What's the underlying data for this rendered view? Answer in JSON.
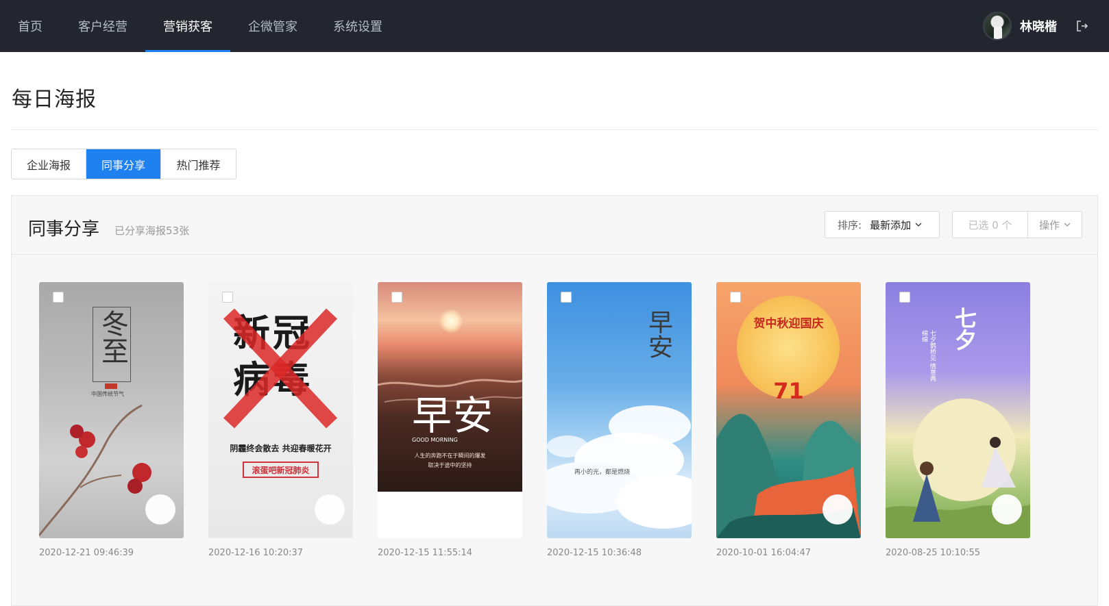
{
  "nav": {
    "items": [
      {
        "label": "首页",
        "active": false
      },
      {
        "label": "客户经营",
        "active": false
      },
      {
        "label": "营销获客",
        "active": true
      },
      {
        "label": "企微管家",
        "active": false
      },
      {
        "label": "系统设置",
        "active": false
      }
    ],
    "username": "林晓楷"
  },
  "page": {
    "title": "每日海报"
  },
  "tabs": [
    {
      "label": "企业海报",
      "active": false
    },
    {
      "label": "同事分享",
      "active": true
    },
    {
      "label": "热门推荐",
      "active": false
    }
  ],
  "panel": {
    "title": "同事分享",
    "subtitle": "已分享海报53张",
    "sort_label": "排序:",
    "sort_value": "最新添加",
    "selected_label": "已选 0 个",
    "ops_label": "操作"
  },
  "cards": [
    {
      "date": "2020-12-21 09:46:39",
      "poster_text": "冬至",
      "poster_sub": "中国传统节气"
    },
    {
      "date": "2020-12-16 10:20:37",
      "poster_text": "新冠病毒",
      "poster_line1": "阴霾终会散去 共迎春暖花开",
      "poster_line2": "滚蛋吧新冠肺炎"
    },
    {
      "date": "2020-12-15 11:55:14",
      "poster_text": "早安",
      "poster_sub": "GOOD MORNING",
      "poster_line1": "人生的奔跑不在于瞬间的爆发",
      "poster_line2": "取决于途中的坚持"
    },
    {
      "date": "2020-12-15 10:36:48",
      "poster_text": "早安",
      "poster_line1": "再小的光，都是燃烧"
    },
    {
      "date": "2020-10-01 16:04:47",
      "poster_text": "贺中秋迎国庆",
      "poster_num": "71"
    },
    {
      "date": "2020-08-25 10:10:55",
      "poster_text": "七夕",
      "poster_line1": "七夕鹊桥见 情意两绵绵"
    }
  ],
  "colors": {
    "nav_bg": "#23262e",
    "accent": "#1f80f0"
  }
}
